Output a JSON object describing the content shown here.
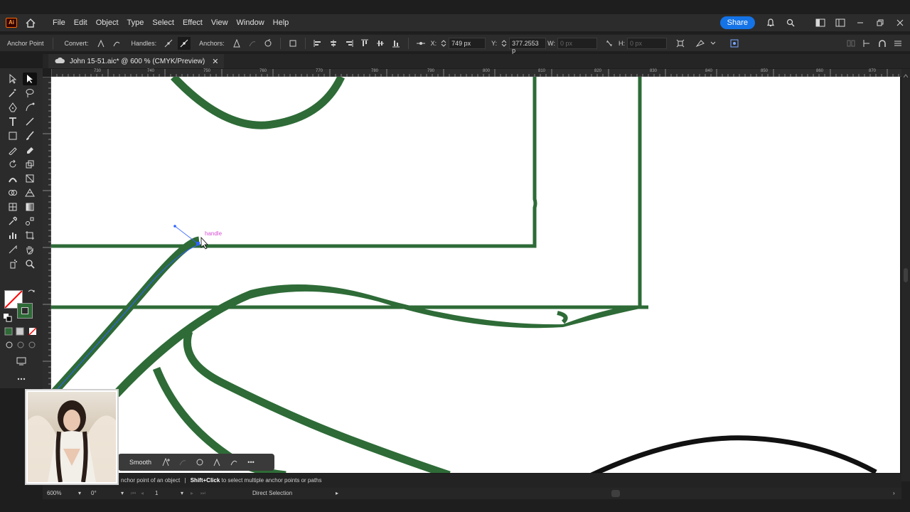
{
  "app": {
    "logo": "Ai",
    "home_icon": "home-icon"
  },
  "menu": {
    "items": [
      "File",
      "Edit",
      "Object",
      "Type",
      "Select",
      "Effect",
      "View",
      "Window",
      "Help"
    ]
  },
  "menubar_right": {
    "share_label": "Share",
    "icons": [
      "bell-icon",
      "search-icon",
      "arrange-icon",
      "panel-icon",
      "minimize-icon",
      "restore-icon",
      "close-icon"
    ]
  },
  "control": {
    "tool_label": "Anchor Point",
    "convert_label": "Convert:",
    "handles_label": "Handles:",
    "anchors_label": "Anchors:",
    "x_label": "X:",
    "x_value": "749 px",
    "y_label": "Y:",
    "y_value": "377.2553 p",
    "w_label": "W:",
    "w_value": "0 px",
    "h_label": "H:",
    "h_value": "0 px"
  },
  "document": {
    "tab_title": "John 15-51.aic* @ 600 % (CMYK/Preview)",
    "close_glyph": "✕"
  },
  "ruler": {
    "labels": [
      "730",
      "740",
      "750",
      "760",
      "770",
      "780",
      "790",
      "800",
      "810",
      "820",
      "830",
      "840",
      "850",
      "860",
      "870"
    ]
  },
  "canvas": {
    "handle_hint": "handle",
    "stroke_color": "#2e6b37"
  },
  "context_bar": {
    "smooth_label": "Smooth",
    "more_glyph": "•••"
  },
  "hint": {
    "text1": "nchor point of an object",
    "sep": "|",
    "bold": "Shift+Click",
    "text2": "to select multiple anchor points or paths"
  },
  "status": {
    "zoom": "600%",
    "rotation": "0°",
    "artboard": "1",
    "tool": "Direct Selection"
  },
  "colors": {
    "fill": "#2e6b37",
    "stroke_none": "#ff0000",
    "accent": "#1473e6"
  }
}
